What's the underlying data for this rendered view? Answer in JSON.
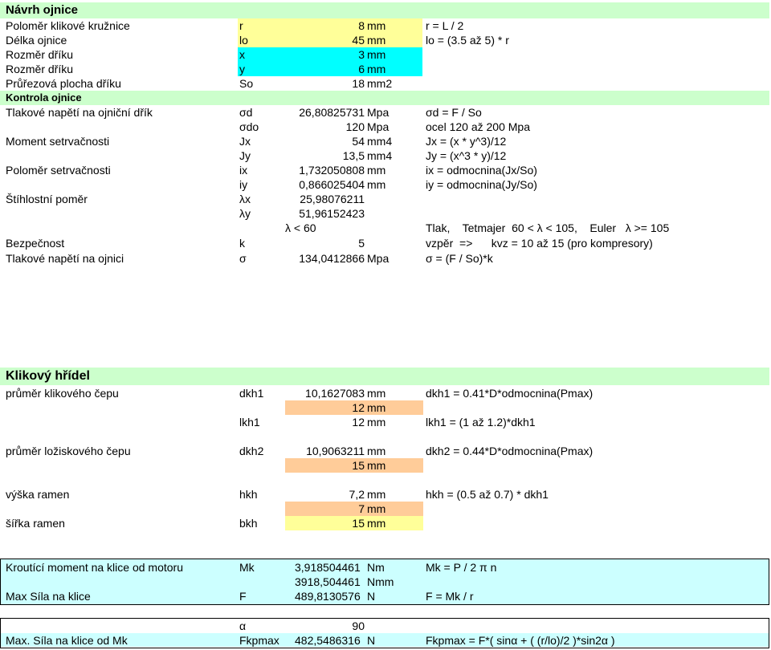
{
  "section1": {
    "title": "Návrh ojnice",
    "rows": [
      {
        "label": "Poloměr klikové kružnice",
        "symbol": "r",
        "value": "8",
        "unit": "mm",
        "formula": "r = L / 2"
      },
      {
        "label": "Délka ojnice",
        "symbol": "lo",
        "value": "45",
        "unit": "mm",
        "formula": "lo = (3.5 až 5) * r"
      },
      {
        "label": "Rozměr dříku",
        "symbol": "x",
        "value": "3",
        "unit": "mm",
        "formula": ""
      },
      {
        "label": "Rozměr dříku",
        "symbol": "y",
        "value": "6",
        "unit": "mm",
        "formula": ""
      },
      {
        "label": "Průřezová plocha dříku",
        "symbol": "So",
        "value": "18",
        "unit": "mm2",
        "formula": ""
      }
    ],
    "subheader": "Kontrola ojnice",
    "check_rows": [
      {
        "label": "Tlakové napětí na ojniční dřík",
        "symbol": "σd",
        "value": "26,80825731",
        "unit": "Mpa",
        "formula": "σd = F / So"
      },
      {
        "label": "",
        "symbol": "σdo",
        "value": "120",
        "unit": "Mpa",
        "formula": "ocel 120 až 200 Mpa"
      },
      {
        "label": "Moment setrvačnosti",
        "symbol": "Jx",
        "value": "54",
        "unit": "mm4",
        "formula": "Jx = (x * y^3)/12"
      },
      {
        "label": "",
        "symbol": "Jy",
        "value": "13,5",
        "unit": "mm4",
        "formula": "Jy = (x^3 * y)/12"
      },
      {
        "label": "Poloměr setrvačnosti",
        "symbol": "ix",
        "value": "1,732050808",
        "unit": "mm",
        "formula": "ix = odmocnina(Jx/So)"
      },
      {
        "label": "",
        "symbol": "iy",
        "value": "0,866025404",
        "unit": "mm",
        "formula": "iy = odmocnina(Jy/So)"
      },
      {
        "label": "Štíhlostní poměr",
        "symbol": "λx",
        "value": "25,98076211",
        "unit": "",
        "formula": ""
      },
      {
        "label": "",
        "symbol": "λy",
        "value": "51,96152423",
        "unit": "",
        "formula": ""
      }
    ],
    "lambda_condition": "λ < 60",
    "lambda_note": "Tlak,    Tetmajer  60 < λ < 105,    Euler   λ >= 105",
    "safety": {
      "label": "Bezpečnost",
      "symbol": "k",
      "value": "5",
      "formula": "vzpěr  =>      kvz = 10 až 15 (pro kompresory)"
    },
    "stress": {
      "label": "Tlakové napětí na ojnici",
      "symbol": "σ",
      "value": "134,0412866",
      "unit": "Mpa",
      "formula": "σ = (F / So)*k"
    }
  },
  "section2": {
    "title": "Klikový hřídel",
    "crank_pin": {
      "label": "průměr klikového čepu",
      "symbol": "dkh1",
      "value": "10,1627083",
      "unit": "mm",
      "formula": "dkh1 = 0.41*D*odmocnina(Pmax)",
      "chosen_value": "12",
      "chosen_unit": "mm"
    },
    "pin_length": {
      "symbol": "lkh1",
      "value": "12",
      "unit": "mm",
      "formula": "lkh1 = (1 až 1.2)*dkh1"
    },
    "journal": {
      "label": "průměr ložiskového čepu",
      "symbol": "dkh2",
      "value": "10,9063211",
      "unit": "mm",
      "formula": "dkh2 = 0.44*D*odmocnina(Pmax)",
      "chosen_value": "15",
      "chosen_unit": "mm"
    },
    "web_height": {
      "label": "výška ramen",
      "symbol": "hkh",
      "value": "7,2",
      "unit": "mm",
      "formula": "hkh = (0.5 až 0.7) * dkh1",
      "chosen_value": "7",
      "chosen_unit": "mm"
    },
    "web_width": {
      "label": "šířka ramen",
      "symbol": "bkh",
      "value": "15",
      "unit": "mm"
    }
  },
  "section3": {
    "torque": {
      "label": "Kroutící moment na klice od motoru",
      "symbol": "Mk",
      "value": "3,918504461",
      "unit": "Nm",
      "formula": "Mk = P / 2 π n",
      "value2": "3918,504461",
      "unit2": "Nmm"
    },
    "force": {
      "label": "Max Síla na klice",
      "symbol": "F",
      "value": "489,8130576",
      "unit": "N",
      "formula": "F = Mk / r"
    }
  },
  "section4": {
    "alpha": {
      "symbol": "α",
      "value": "90"
    },
    "fmax": {
      "label": "Max. Síla na klice od Mk",
      "symbol": "Fkpmax",
      "value": "482,5486316",
      "unit": "N",
      "formula": "Fkpmax = F*( sinα + ( (r/lo)/2 )*sin2α )"
    }
  }
}
